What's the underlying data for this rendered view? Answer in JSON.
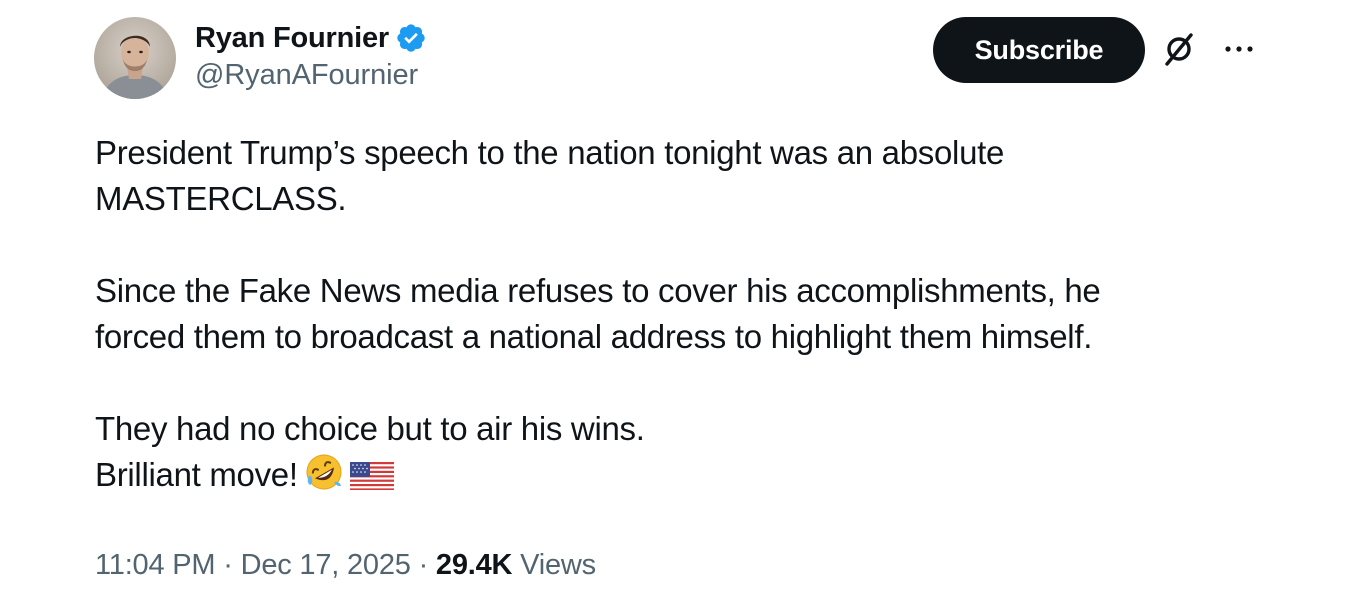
{
  "author": {
    "display_name": "Ryan Fournier",
    "handle": "@RyanAFournier",
    "verified": true,
    "verified_color": "#1d9bf0"
  },
  "actions": {
    "subscribe_label": "Subscribe",
    "grok_icon": "grok-icon",
    "more_icon": "more-options-icon"
  },
  "tweet": {
    "paragraph_1_line_1": "President Trump’s speech to the nation tonight was an absolute",
    "paragraph_1_line_2": "MASTERCLASS.",
    "paragraph_2_line_1": "Since the Fake News media refuses to cover his accomplishments, he",
    "paragraph_2_line_2": "forced them to broadcast a national address to highlight them himself.",
    "paragraph_3_line_1": "They had no choice but to air his wins.",
    "paragraph_3_line_2": "Brilliant move!",
    "emojis": [
      "rolling-on-floor-laughing-emoji",
      "us-flag-emoji"
    ]
  },
  "meta": {
    "time": "11:04 PM",
    "separator": "·",
    "date": "Dec 17, 2025",
    "views_count": "29.4K",
    "views_label": "Views"
  },
  "colors": {
    "text_primary": "#0f1419",
    "text_secondary": "#536471",
    "button_bg": "#0f1419",
    "button_text": "#ffffff"
  }
}
